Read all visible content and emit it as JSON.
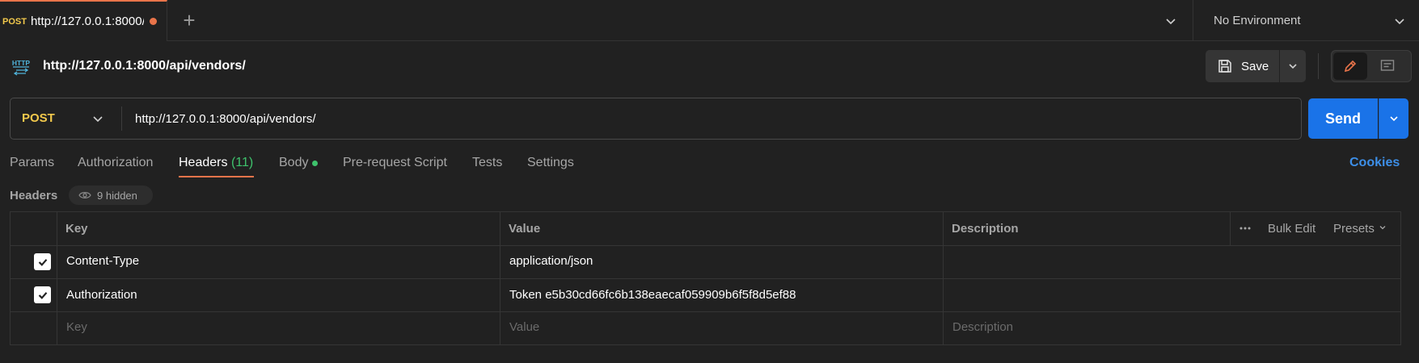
{
  "tabbar": {
    "tab_method": "POST",
    "tab_url": "http://127.0.0.1:8000/api/vendors/",
    "environment": "No Environment"
  },
  "request": {
    "icon_text": "HTTP",
    "title": "http://127.0.0.1:8000/api/vendors/",
    "save_label": "Save",
    "method": "POST",
    "url": "http://127.0.0.1:8000/api/vendors/",
    "send_label": "Send"
  },
  "subtabs": {
    "params": "Params",
    "authorization": "Authorization",
    "headers": "Headers",
    "headers_count": "(11)",
    "body": "Body",
    "prerequest": "Pre-request Script",
    "tests": "Tests",
    "settings": "Settings",
    "cookies": "Cookies"
  },
  "headers_section": {
    "label": "Headers",
    "hidden": "9 hidden"
  },
  "table": {
    "columns": {
      "key": "Key",
      "value": "Value",
      "description": "Description"
    },
    "bulk_edit": "Bulk Edit",
    "presets": "Presets",
    "rows": [
      {
        "checked": true,
        "key": "Content-Type",
        "value": "application/json",
        "description": ""
      },
      {
        "checked": true,
        "key": "Authorization",
        "value": "Token e5b30cd66fc6b138eaecaf059909b6f5f8d5ef88",
        "description": ""
      }
    ],
    "placeholders": {
      "key": "Key",
      "value": "Value",
      "description": "Description"
    }
  },
  "colors": {
    "accent": "#e9744a",
    "post": "#f2c94c",
    "send": "#1a73e8",
    "success": "#3ec26c",
    "link": "#3d8fe8"
  }
}
